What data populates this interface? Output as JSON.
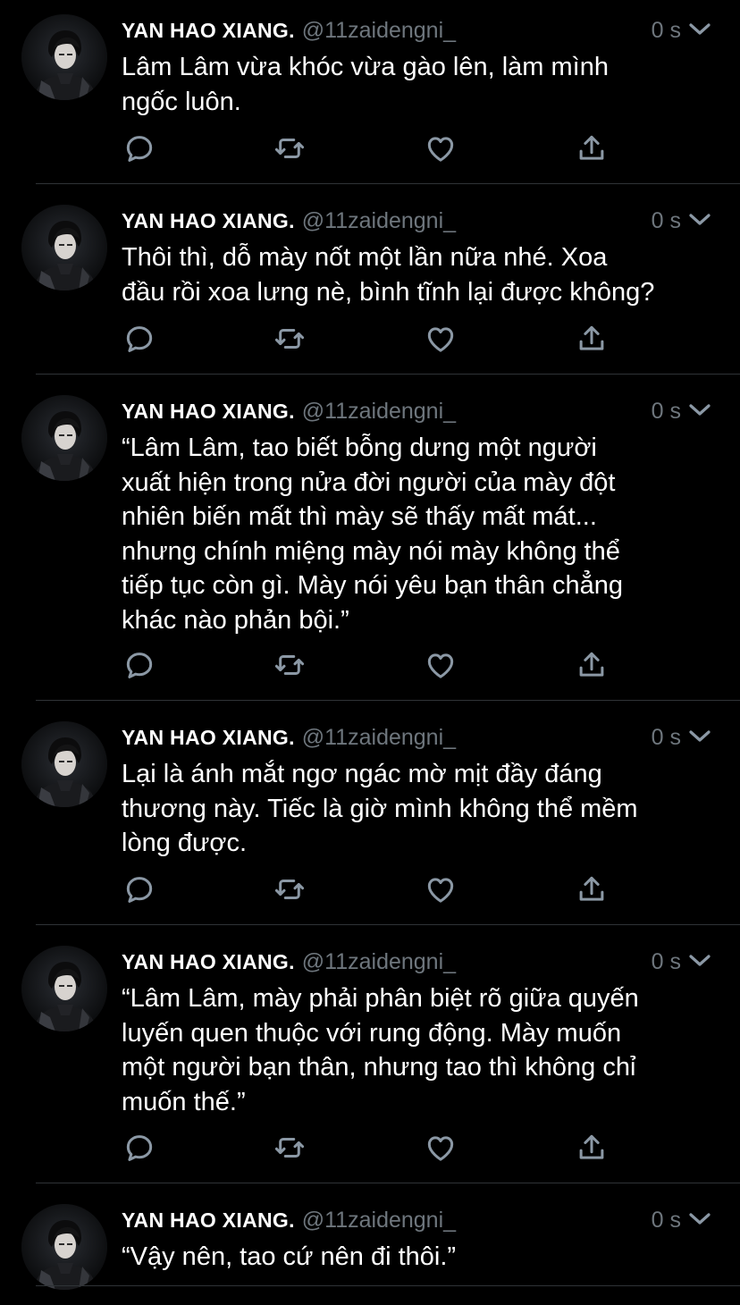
{
  "colors": {
    "background": "#000000",
    "text": "#ffffff",
    "secondary": "#6e767d",
    "icon": "#8b98a5",
    "divider": "#2f3336"
  },
  "icons": [
    "reply-icon",
    "retweet-icon",
    "like-icon",
    "share-icon",
    "chevron-down-icon",
    "avatar"
  ],
  "tweets": [
    {
      "author": "YAN HAO XIANG.",
      "handle": "@11zaidengni_",
      "time": "0 s",
      "text": "Lâm Lâm vừa khóc vừa gào lên, làm mình\nngốc luôn."
    },
    {
      "author": "YAN HAO XIANG.",
      "handle": "@11zaidengni_",
      "time": "0 s",
      "text": "Thôi thì, dỗ mày nốt một lần nữa nhé. Xoa\nđầu rồi xoa lưng nè, bình tĩnh lại được không?"
    },
    {
      "author": "YAN HAO XIANG.",
      "handle": "@11zaidengni_",
      "time": "0 s",
      "text": "“Lâm Lâm, tao biết bỗng dưng một người\nxuất hiện trong nửa đời người của mày đột\nnhiên biến mất thì mày sẽ thấy mất mát...\nnhưng chính miệng mày nói mày không thể\ntiếp tục còn gì. Mày nói yêu bạn thân chẳng\nkhác nào phản bội.”"
    },
    {
      "author": "YAN HAO XIANG.",
      "handle": "@11zaidengni_",
      "time": "0 s",
      "text": "Lại là ánh mắt ngơ ngác mờ mịt đầy đáng\nthương này. Tiếc là giờ mình không thể mềm\nlòng được."
    },
    {
      "author": "YAN HAO XIANG.",
      "handle": "@11zaidengni_",
      "time": "0 s",
      "text": "“Lâm Lâm, mày phải phân biệt rõ giữa quyến\nluyến quen thuộc với rung động. Mày muốn\nmột người bạn thân, nhưng tao thì không chỉ\nmuốn thế.”"
    },
    {
      "author": "YAN HAO XIANG.",
      "handle": "@11zaidengni_",
      "time": "0 s",
      "text": "“Vậy nên, tao cứ nên đi thôi.”"
    }
  ]
}
